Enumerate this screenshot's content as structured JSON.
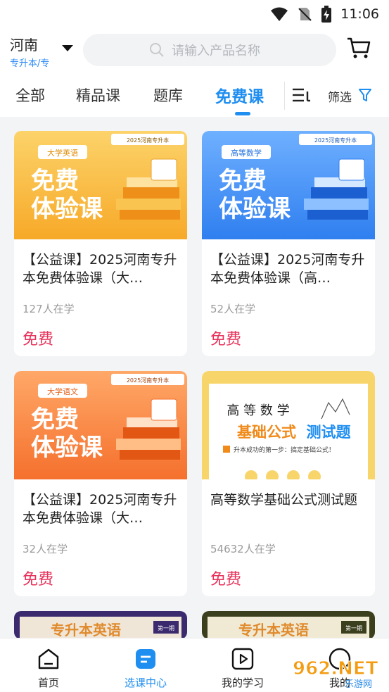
{
  "status_bar": {
    "time": "11:06"
  },
  "header": {
    "region_main": "河南",
    "region_sub": "专升本/专",
    "search_placeholder": "请输入产品名称"
  },
  "tabs": {
    "items": [
      "全部",
      "精品课",
      "题库",
      "免费课"
    ],
    "active": "免费课",
    "filter_label": "筛选"
  },
  "cards": [
    {
      "title": "【公益课】2025河南专升本免费体验课（大…",
      "students": "127人在学",
      "price": "免费",
      "thumb": {
        "tag": "大学英语",
        "big1": "免费",
        "big2": "体验课",
        "corner": "2025河南专升本",
        "theme": "#f9b233"
      }
    },
    {
      "title": "【公益课】2025河南专升本免费体验课（高…",
      "students": "52人在学",
      "price": "免费",
      "thumb": {
        "tag": "高等数学",
        "big1": "免费",
        "big2": "体验课",
        "corner": "2025河南专升本",
        "theme": "#3d8df5"
      }
    },
    {
      "title": "【公益课】2025河南专升本免费体验课（大…",
      "students": "32人在学",
      "price": "免费",
      "thumb": {
        "tag": "大学语文",
        "big1": "免费",
        "big2": "体验课",
        "corner": "2025河南专升本",
        "theme": "#f5803d"
      }
    },
    {
      "title": "高等数学基础公式测试题",
      "students": "54632人在学",
      "price": "免费",
      "thumb": {
        "heading": "高 等 数 学",
        "main1": "基础公式",
        "main2": "测试题",
        "sub": "升本成功的第一步：搞定基础公式！"
      }
    }
  ],
  "peek_cards": [
    {
      "text": "专升本英语",
      "badge": "第一期"
    },
    {
      "text": "专升本英语",
      "badge": "第一期"
    }
  ],
  "bottom_nav": {
    "items": [
      "首页",
      "选课中心",
      "我的学习",
      "我的"
    ],
    "active": "选课中心"
  },
  "colors": {
    "accent": "#1f8ef1",
    "price": "#e8315a"
  },
  "watermark": {
    "text": "962.NET",
    "sub": "乐游网"
  }
}
